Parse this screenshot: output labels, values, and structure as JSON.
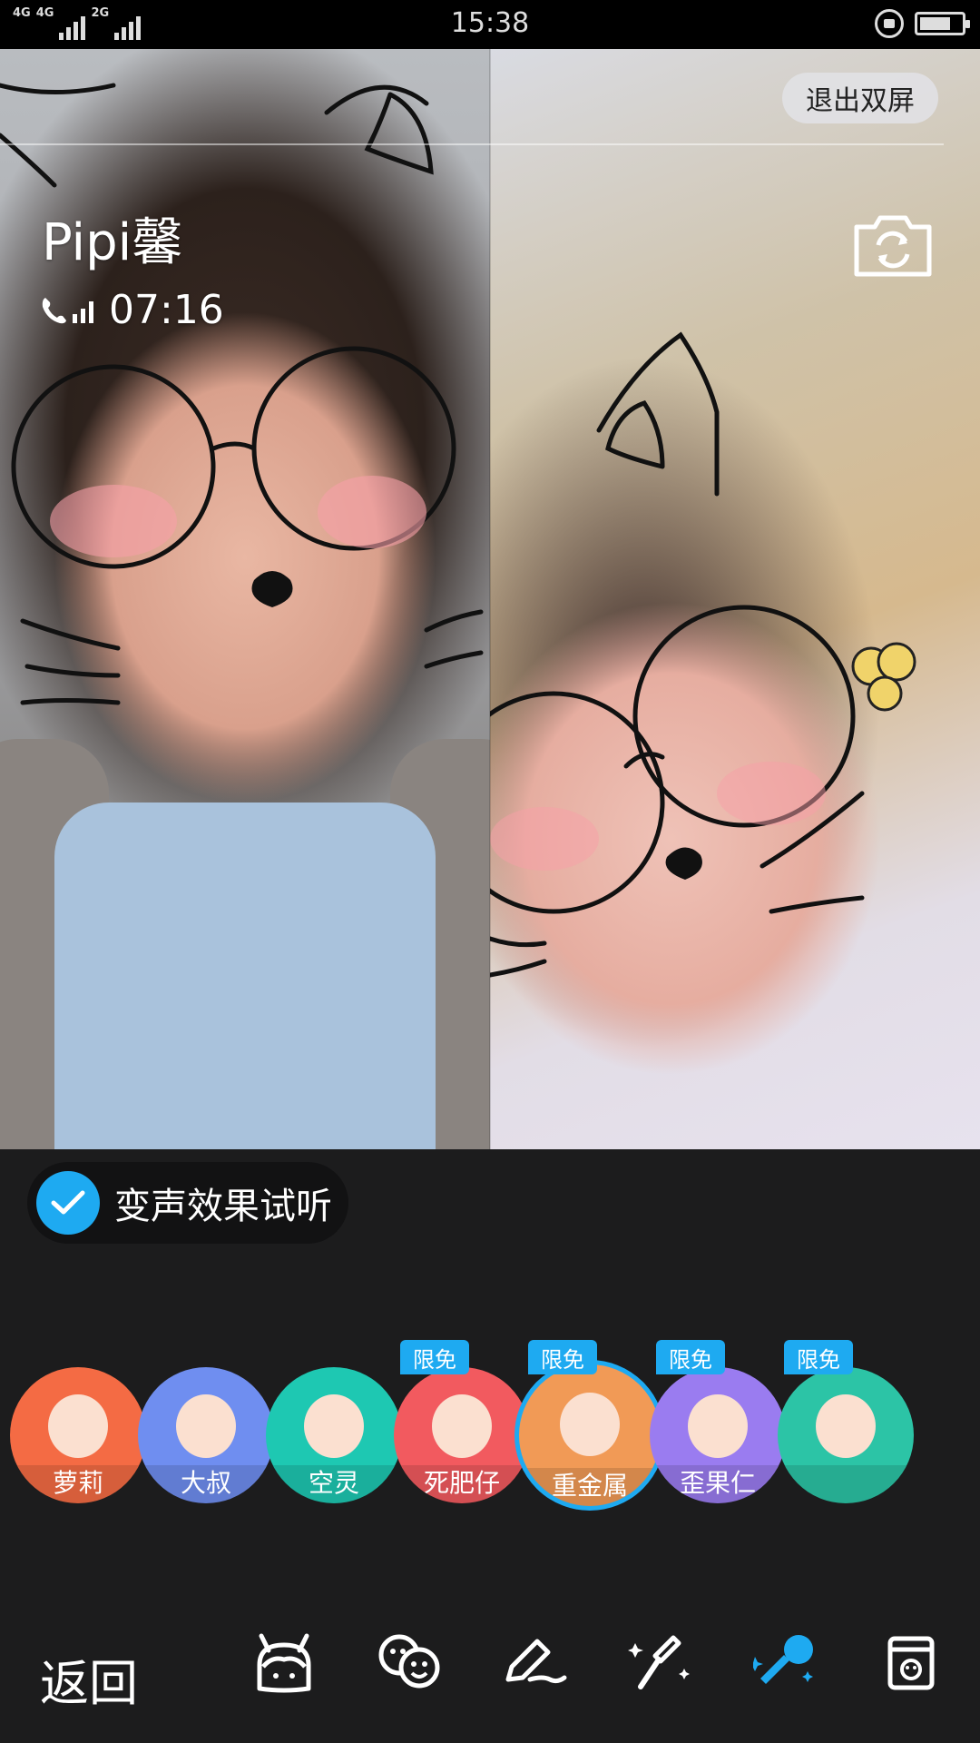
{
  "status_bar": {
    "network_labels": [
      "4G",
      "4G",
      "2G"
    ],
    "time": "15:38",
    "battery_level": 0.75
  },
  "call": {
    "caller_name": "Pipi馨",
    "duration": "07:16",
    "exit_dual_label": "退出双屏"
  },
  "voice_preview": {
    "label": "变声效果试听",
    "checked": true
  },
  "voices": [
    {
      "name": "萝莉",
      "badge": "",
      "color": "#f46b44"
    },
    {
      "name": "大叔",
      "badge": "",
      "color": "#6f8ef0"
    },
    {
      "name": "空灵",
      "badge": "",
      "color": "#1ec8b2"
    },
    {
      "name": "死肥仔",
      "badge": "限免",
      "color": "#f25a5f"
    },
    {
      "name": "重金属",
      "badge": "限免",
      "color": "#f19a56",
      "selected": true
    },
    {
      "name": "歪果仁",
      "badge": "限免",
      "color": "#9a7cf0"
    },
    {
      "name": "",
      "badge": "限免",
      "color": "#2cc4a6"
    }
  ],
  "toolbar": {
    "back_label": "返回",
    "tools": [
      "pendant-icon",
      "face-sticker-icon",
      "graffiti-pen-icon",
      "beauty-wand-icon",
      "voice-change-icon",
      "card-icon"
    ],
    "active_tool": "voice-change-icon",
    "active_color": "#1eaaf1"
  }
}
